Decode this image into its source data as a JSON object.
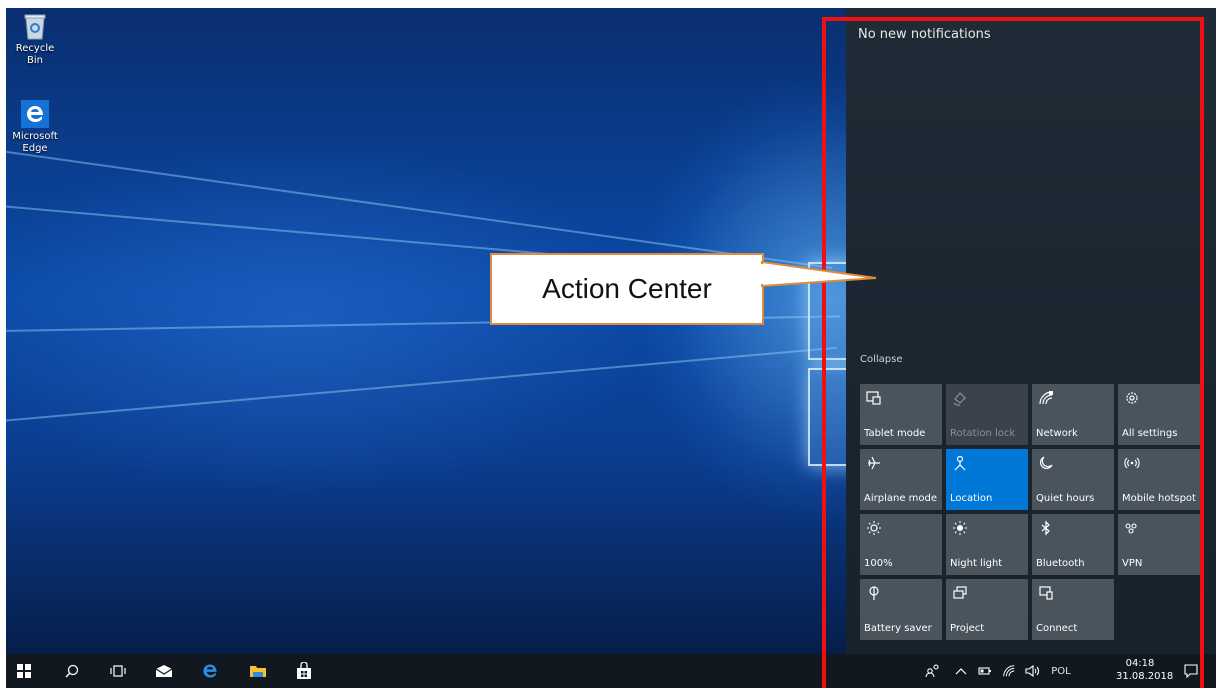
{
  "desktop": {
    "icons": [
      {
        "label": "Recycle Bin",
        "icon": "recycle-bin-icon"
      },
      {
        "label": "Microsoft Edge",
        "icon": "edge-icon"
      }
    ]
  },
  "action_center": {
    "title": "No new notifications",
    "collapse_label": "Collapse",
    "tiles": [
      {
        "label": "Tablet mode",
        "icon": "tablet-mode-icon",
        "state": "off"
      },
      {
        "label": "Rotation lock",
        "icon": "rotation-lock-icon",
        "state": "disabled"
      },
      {
        "label": "Network",
        "icon": "network-icon",
        "state": "off"
      },
      {
        "label": "All settings",
        "icon": "gear-icon",
        "state": "off"
      },
      {
        "label": "Airplane mode",
        "icon": "airplane-icon",
        "state": "off"
      },
      {
        "label": "Location",
        "icon": "location-icon",
        "state": "on"
      },
      {
        "label": "Quiet hours",
        "icon": "moon-icon",
        "state": "off"
      },
      {
        "label": "Mobile hotspot",
        "icon": "hotspot-icon",
        "state": "off"
      },
      {
        "label": "100%",
        "icon": "brightness-icon",
        "state": "off"
      },
      {
        "label": "Night light",
        "icon": "night-light-icon",
        "state": "off"
      },
      {
        "label": "Bluetooth",
        "icon": "bluetooth-icon",
        "state": "off"
      },
      {
        "label": "VPN",
        "icon": "vpn-icon",
        "state": "off"
      },
      {
        "label": "Battery saver",
        "icon": "battery-saver-icon",
        "state": "off"
      },
      {
        "label": "Project",
        "icon": "project-icon",
        "state": "off"
      },
      {
        "label": "Connect",
        "icon": "connect-icon",
        "state": "off"
      }
    ],
    "active_color": "#0078d7"
  },
  "annotation": {
    "callout_text": "Action Center",
    "highlight_color": "#ee1111",
    "callout_border_color": "#e08a3a"
  },
  "taskbar": {
    "buttons": [
      "start-icon",
      "search-icon",
      "task-view-icon",
      "mail-icon",
      "edge-icon",
      "file-explorer-icon",
      "store-icon"
    ],
    "tray": {
      "language": "POL",
      "time": "04:18",
      "date": "31.08.2018"
    }
  }
}
